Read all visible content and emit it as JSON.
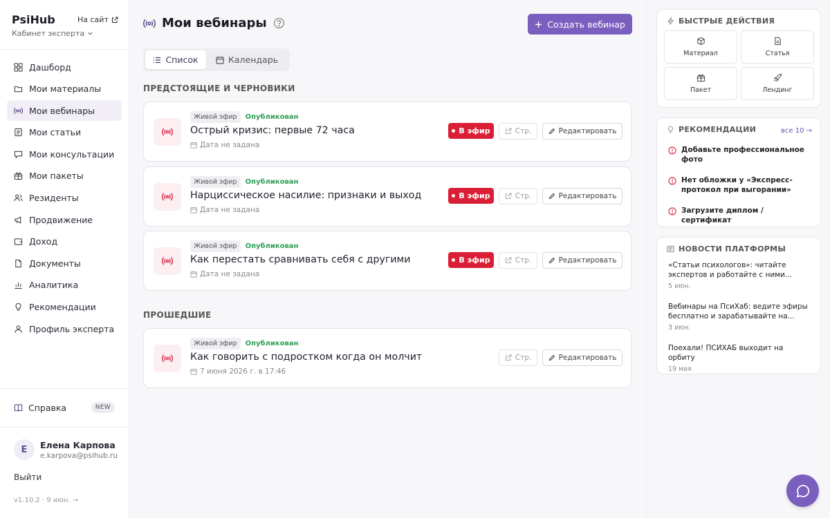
{
  "sidebar": {
    "brand": "PsiHub",
    "site_link": "На сайт",
    "cabinet": "Кабинет эксперта",
    "items": [
      {
        "label": "Дашборд",
        "icon": "dashboard-icon"
      },
      {
        "label": "Мои материалы",
        "icon": "folder-icon"
      },
      {
        "label": "Мои вебинары",
        "icon": "broadcast-icon",
        "active": true
      },
      {
        "label": "Мои статьи",
        "icon": "article-icon"
      },
      {
        "label": "Мои консультации",
        "icon": "chat-icon"
      },
      {
        "label": "Мои пакеты",
        "icon": "package-icon"
      },
      {
        "label": "Резиденты",
        "icon": "users-icon"
      },
      {
        "label": "Продвижение",
        "icon": "megaphone-icon"
      },
      {
        "label": "Доход",
        "icon": "wallet-icon"
      },
      {
        "label": "Документы",
        "icon": "document-icon"
      },
      {
        "label": "Аналитика",
        "icon": "chart-icon"
      },
      {
        "label": "Рекомендации",
        "icon": "bulb-icon"
      },
      {
        "label": "Профиль эксперта",
        "icon": "user-icon"
      }
    ],
    "help": {
      "label": "Справка",
      "badge": "NEW"
    },
    "user": {
      "initial": "Е",
      "name": "Елена Карпова",
      "email": "e.karpova@psihub.ru"
    },
    "logout": "Выйти",
    "version": "v1.10.2 · 9 июн. →"
  },
  "main": {
    "title": "Мои вебинары",
    "create_button": "Создать вебинар",
    "tabs": [
      {
        "label": "Список",
        "active": true
      },
      {
        "label": "Календарь",
        "active": false
      }
    ],
    "upcoming_title": "ПРЕДСТОЯЩИЕ И ЧЕРНОВИКИ",
    "past_title": "ПРОШЕДШИЕ",
    "upcoming": [
      {
        "type": "Живой эфир",
        "status": "Опубликован",
        "title": "Острый кризис: первые 72 часа",
        "date": "Дата не задана",
        "live": "В эфир",
        "page": "Стр.",
        "edit": "Редактировать"
      },
      {
        "type": "Живой эфир",
        "status": "Опубликован",
        "title": "Нарциссическое насилие: признаки и выход",
        "date": "Дата не задана",
        "live": "В эфир",
        "page": "Стр.",
        "edit": "Редактировать"
      },
      {
        "type": "Живой эфир",
        "status": "Опубликован",
        "title": "Как перестать сравнивать себя с другими",
        "date": "Дата не задана",
        "live": "В эфир",
        "page": "Стр.",
        "edit": "Редактировать"
      }
    ],
    "past": [
      {
        "type": "Живой эфир",
        "status": "Опубликован",
        "title": "Как говорить с подростком когда он молчит",
        "date": "7 июня 2026 г. в 17:46",
        "page": "Стр.",
        "edit": "Редактировать"
      }
    ]
  },
  "right": {
    "quick_title": "БЫСТРЫЕ ДЕЙСТВИЯ",
    "quick": [
      {
        "label": "Материал",
        "icon": "cube-icon"
      },
      {
        "label": "Статья",
        "icon": "file-icon"
      },
      {
        "label": "Пакет",
        "icon": "gift-icon"
      },
      {
        "label": "Лендинг",
        "icon": "rocket-icon"
      }
    ],
    "rec_title": "РЕКОМЕНДАЦИИ",
    "rec_all": "все 10 →",
    "recs": [
      "Добавьте профессиональное фото",
      "Нет обложки у «Экспресс-протокол при выгорании»",
      "Загрузите диплом / сертификат"
    ],
    "news_title": "НОВОСТИ ПЛАТФОРМЫ",
    "news": [
      {
        "title": "«Статьи психологов»: читайте экспертов и работайте с ними...",
        "date": "5 июн."
      },
      {
        "title": "Вебинары на ПсиХаб: ведите эфиры бесплатно и зарабатывайте на...",
        "date": "3 июн."
      },
      {
        "title": "Поехали! ПСИХАБ выходит на орбиту",
        "date": "19 мая"
      }
    ]
  },
  "colors": {
    "accent": "#7a5fbf",
    "live": "#d91e35",
    "published": "#2f9e55"
  }
}
